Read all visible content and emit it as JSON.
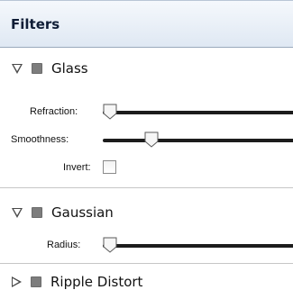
{
  "panel": {
    "title": "Filters"
  },
  "sections": {
    "glass": {
      "label": "Glass",
      "refraction": {
        "label": "Refraction:",
        "value": 0.0
      },
      "smoothness": {
        "label": "Smoothness:",
        "value": 0.25
      },
      "invert": {
        "label": "Invert:",
        "checked": false
      }
    },
    "gaussian": {
      "label": "Gaussian",
      "radius": {
        "label": "Radius:",
        "value": 0.0
      }
    },
    "ripple": {
      "label": "Ripple Distort"
    }
  },
  "icons": {
    "expanded": "triangle-down-icon",
    "collapsed": "triangle-right-icon",
    "enable": "square-toggle-icon"
  },
  "colors": {
    "header_bg": "#dfe8f3",
    "track": "#1c1c1c",
    "title": "#0f1d36"
  }
}
